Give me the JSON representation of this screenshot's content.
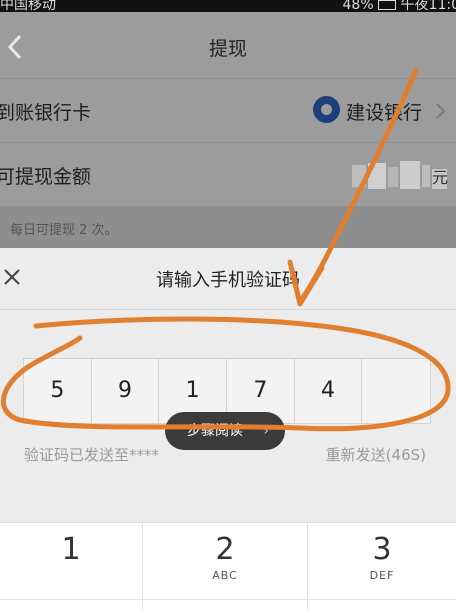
{
  "status_bar": {
    "carrier": "中国移动",
    "battery": "48%",
    "time": "午夜11:0"
  },
  "header": {
    "title": "提现"
  },
  "form": {
    "bank_label": "到账银行卡",
    "bank_name": "建设银行",
    "amount_label": "可提现金额",
    "amount_unit": "元",
    "daily_note": "每日可提现 2 次。"
  },
  "dialog": {
    "title": "请输入手机验证码",
    "code_digits": [
      "5",
      "9",
      "1",
      "7",
      "4",
      ""
    ],
    "sent_text": "验证码已发送至****",
    "resend_label": "重新发送(46S)"
  },
  "toast": {
    "label": "步骤阅读"
  },
  "keypad": {
    "keys": [
      {
        "digit": "1",
        "letters": ""
      },
      {
        "digit": "2",
        "letters": "ABC"
      },
      {
        "digit": "3",
        "letters": "DEF"
      }
    ]
  },
  "colors": {
    "annotation": "#e07f2f",
    "bank_logo": "#1d3f7a"
  },
  "icons": {
    "back": "chevron-left-icon",
    "close": "close-icon",
    "bank": "ccb-logo-icon",
    "row_arrow": "chevron-right-icon"
  }
}
